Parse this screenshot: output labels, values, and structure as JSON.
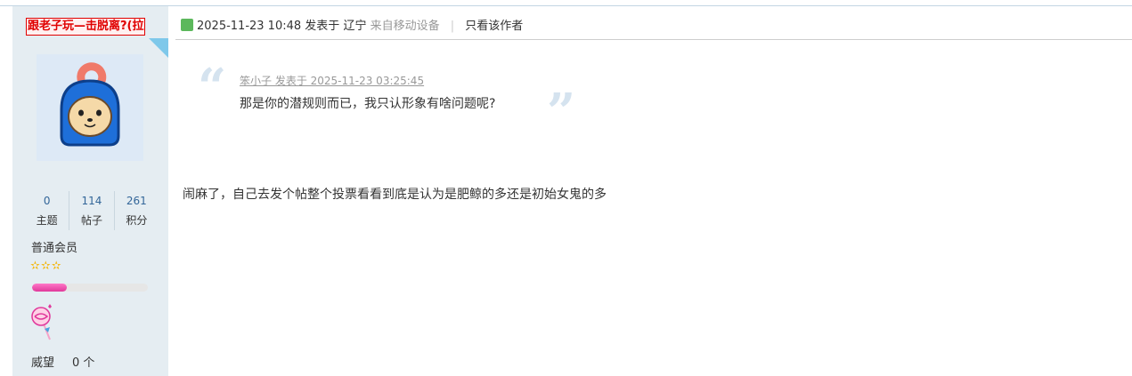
{
  "author": {
    "username": "跟老子玩—击脱离?(拉",
    "stats": [
      {
        "value": "0",
        "label": "主题"
      },
      {
        "value": "114",
        "label": "帖子"
      },
      {
        "value": "261",
        "label": "积分"
      }
    ],
    "group": "普通会员",
    "stars": "✫✫✫",
    "level_progress": 0.3,
    "info": [
      {
        "label": "威望",
        "value": "0 个"
      }
    ]
  },
  "post": {
    "datetime": "2025-11-23 10:48",
    "posted_in": "发表于",
    "location": "辽宁",
    "source": "来自移动设备",
    "separator": "|",
    "only_author": "只看该作者",
    "quote": {
      "meta": "笨小子 发表于 2025-11-23 03:25:45",
      "text": "那是你的潜规则而已，我只认形象有啥问题呢?"
    },
    "reply": "闹麻了，自己去发个帖整个投票看看到底是认为是肥鲸的多还是初始女鬼的多"
  },
  "colors": {
    "username": "#e00000",
    "sidebar_bg": "#e5edf2",
    "progress_fill": "#e0389b",
    "quote_marks": "#d5e3ef"
  }
}
